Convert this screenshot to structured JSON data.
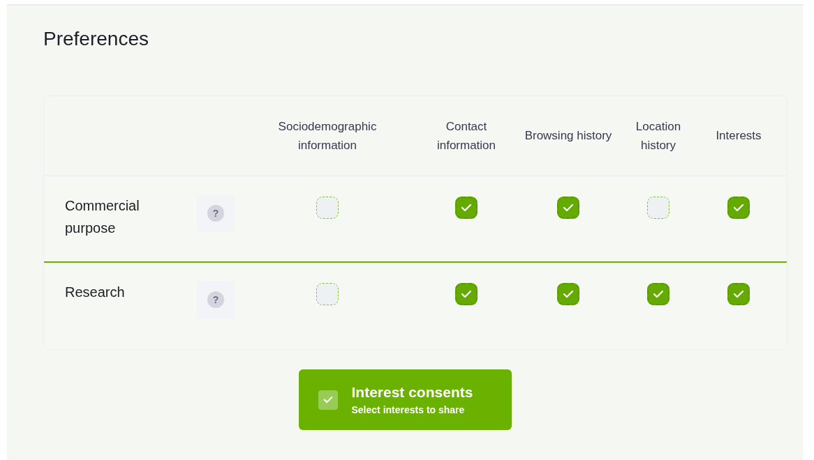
{
  "title": "Preferences",
  "columns": [
    "Sociodemographic information",
    "Contact information",
    "Browsing history",
    "Location history",
    "Interests"
  ],
  "rows": [
    {
      "label": "Commercial purpose",
      "help": "?",
      "selected": true,
      "checks": [
        false,
        true,
        true,
        false,
        true
      ]
    },
    {
      "label": "Research",
      "help": "?",
      "selected": false,
      "checks": [
        false,
        true,
        true,
        true,
        true
      ]
    }
  ],
  "button": {
    "title": "Interest consents",
    "subtitle": "Select interests to share"
  }
}
